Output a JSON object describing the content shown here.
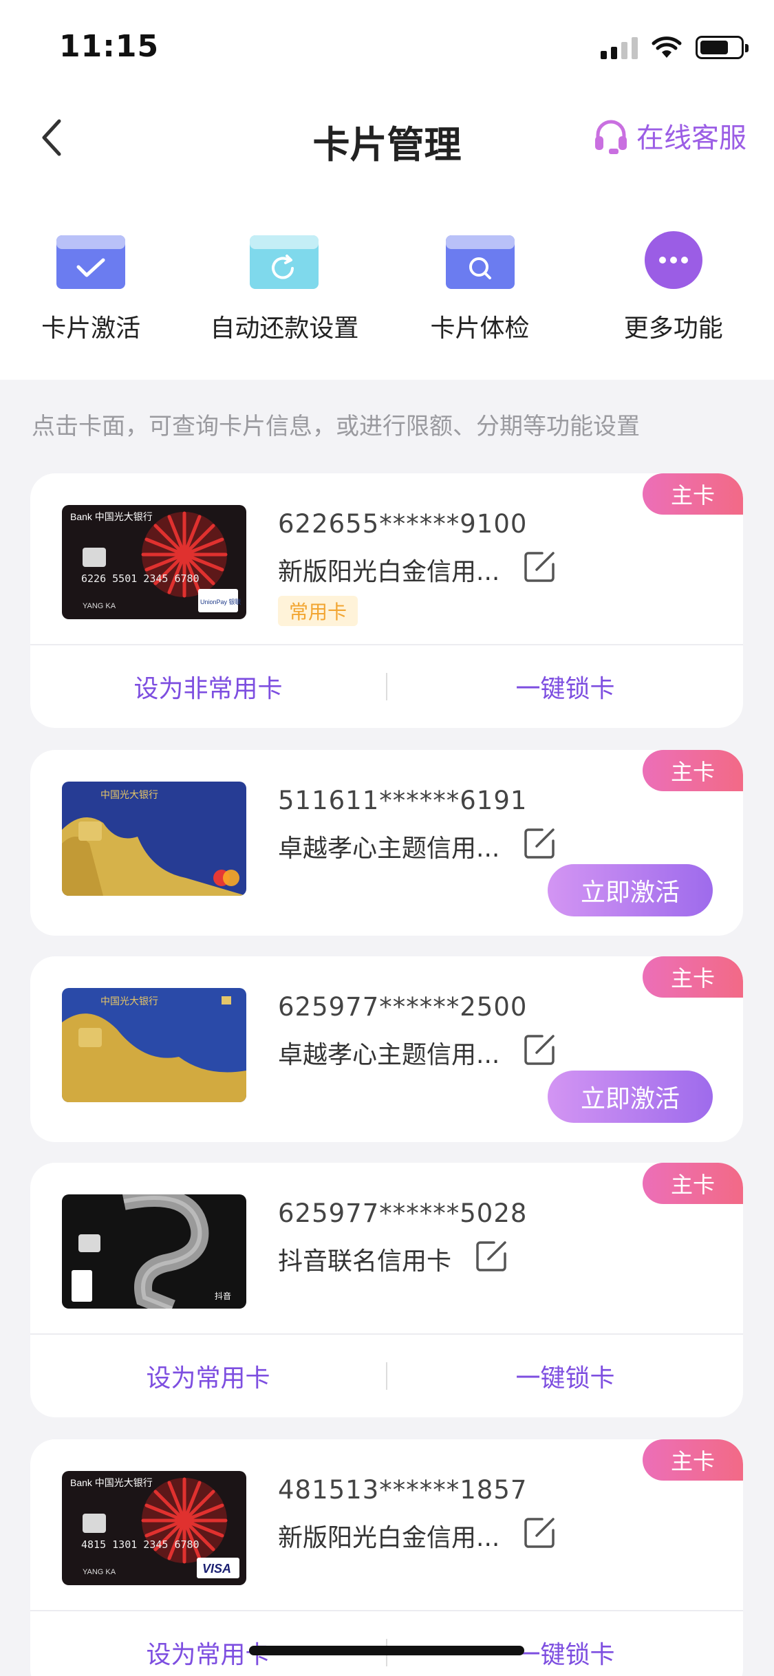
{
  "status_bar": {
    "time": "11:15"
  },
  "nav": {
    "title": "卡片管理",
    "service_label": "在线客服"
  },
  "quick_actions": [
    {
      "label": "卡片激活",
      "icon": "card-check-icon"
    },
    {
      "label": "自动还款设置",
      "icon": "card-refresh-icon"
    },
    {
      "label": "卡片体检",
      "icon": "card-search-icon"
    },
    {
      "label": "更多功能",
      "icon": "more-dots-icon"
    }
  ],
  "hint": "点击卡面，可查询卡片信息，或进行限额、分期等功能设置",
  "cards": [
    {
      "badge": "主卡",
      "number": "622655******9100",
      "name": "新版阳光白金信用...",
      "tag": "常用卡",
      "actions": [
        "设为非常用卡",
        "一键锁卡"
      ],
      "card_bank": "Bank 中国光大银行",
      "card_digits": "6226 5501 2345 6780",
      "card_holder": "YANG KA",
      "card_network": "UnionPay 银联"
    },
    {
      "badge": "主卡",
      "number": "511611******6191",
      "name": "卓越孝心主题信用...",
      "activate_label": "立即激活",
      "card_bank": "中国光大银行"
    },
    {
      "badge": "主卡",
      "number": "625977******2500",
      "name": "卓越孝心主题信用...",
      "activate_label": "立即激活",
      "card_bank": "中国光大银行"
    },
    {
      "badge": "主卡",
      "number": "625977******5028",
      "name": "抖音联名信用卡",
      "actions": [
        "设为常用卡",
        "一键锁卡"
      ],
      "card_brand": "抖音"
    },
    {
      "badge": "主卡",
      "number": "481513******1857",
      "name": "新版阳光白金信用...",
      "actions": [
        "设为常用卡",
        "一键锁卡"
      ],
      "card_bank": "Bank 中国光大银行",
      "card_digits": "4815 1301 2345 6780",
      "card_holder": "YANG KA",
      "card_network": "VISA"
    }
  ],
  "colors": {
    "accent": "#9b5de5",
    "badge": "#ec6fb8",
    "tag": "#f2a531"
  }
}
